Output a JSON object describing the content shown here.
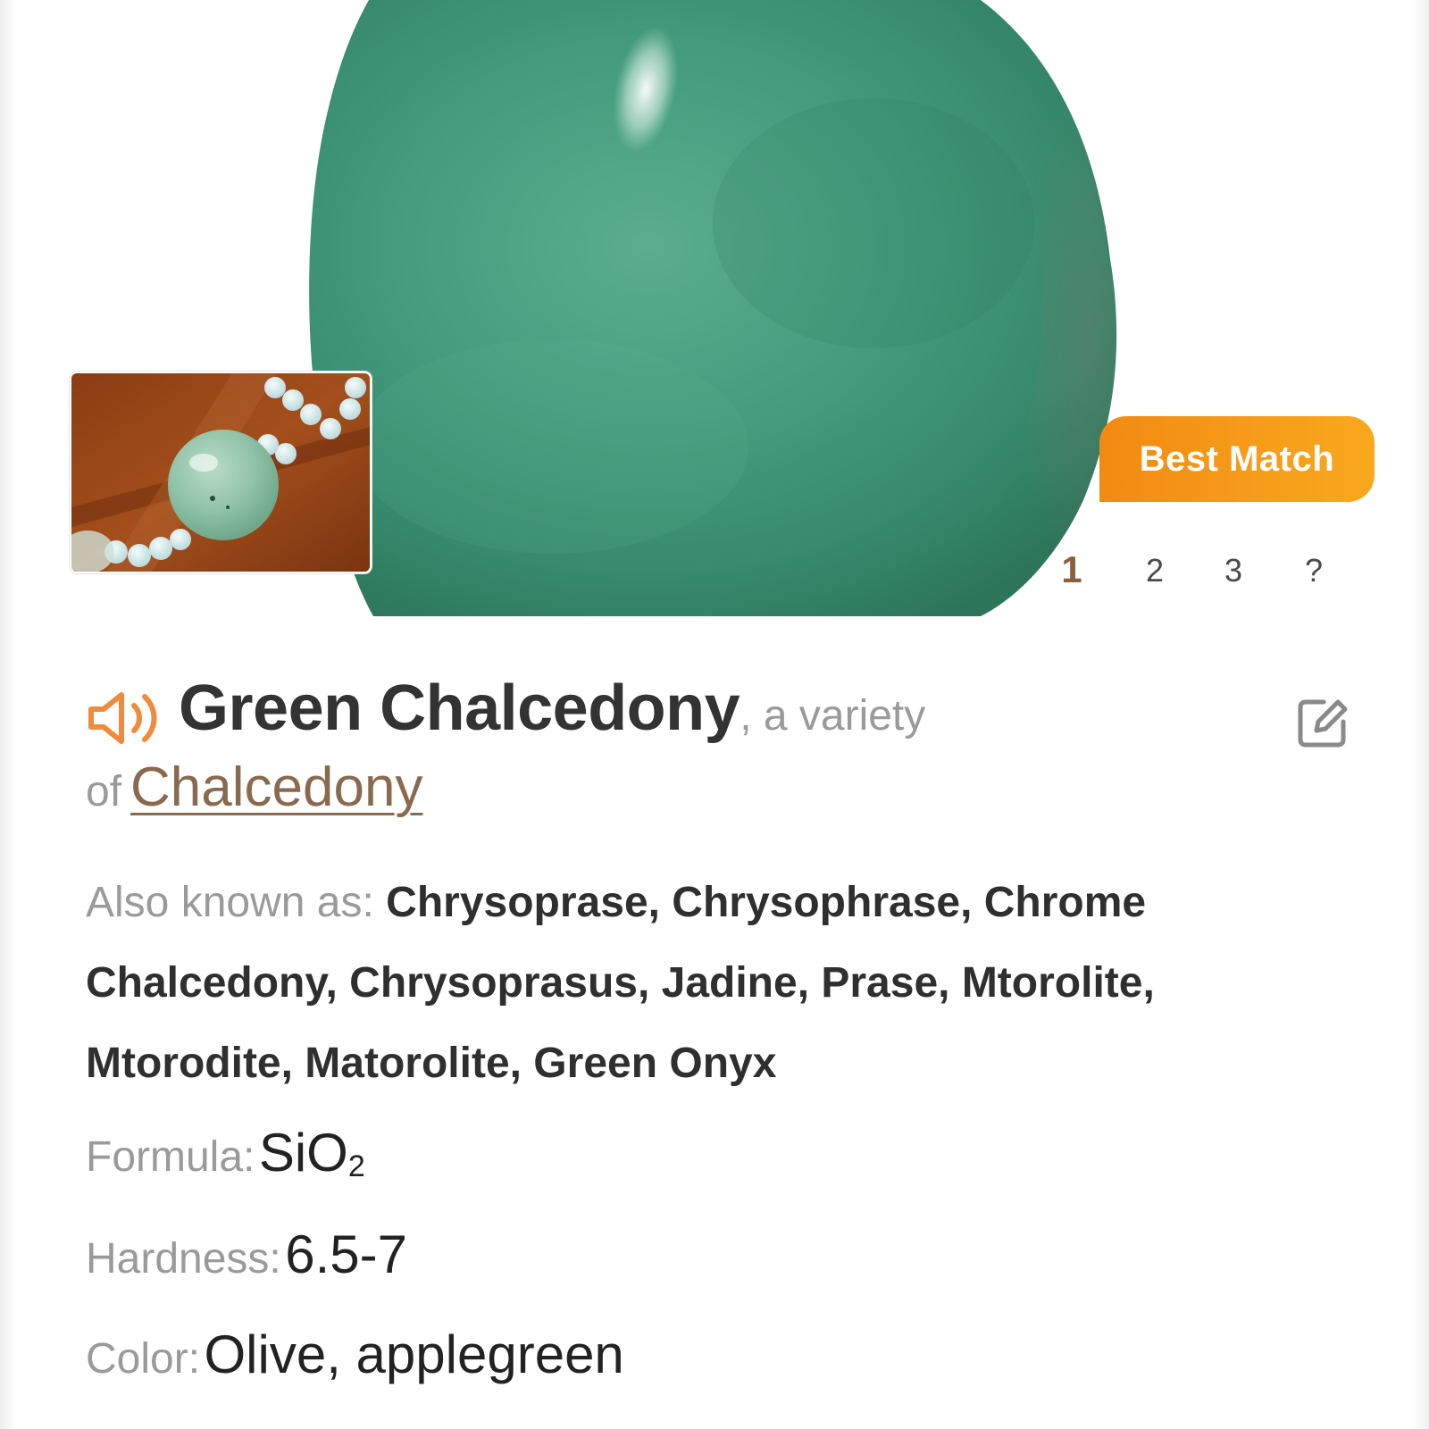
{
  "result": {
    "badge": "Best Match",
    "pager": {
      "pages": [
        "1",
        "2",
        "3",
        "?"
      ],
      "active": "1"
    },
    "name": "Green Chalcedony",
    "variety_prefix": ", a variety",
    "of_word": "of",
    "parent": "Chalcedony",
    "also_known_as_label": "Also known as:",
    "also_known_as": "Chrysoprase, Chrysophrase, Chrome Chalcedony, Chrysoprasus, Jadine, Prase, Mtorolite, Mtorodite, Matorolite, Green Onyx",
    "formula_label": "Formula:",
    "formula_main": "SiO",
    "formula_sub": "2",
    "hardness_label": "Hardness:",
    "hardness": "6.5-7",
    "color_label": "Color:",
    "color": "Olive, applegreen"
  },
  "icons": {
    "audio": "speaker-icon",
    "edit": "edit-icon"
  },
  "colors": {
    "accent": "#f28a12",
    "link": "#8a6a4f",
    "stone": "#3f9577"
  }
}
